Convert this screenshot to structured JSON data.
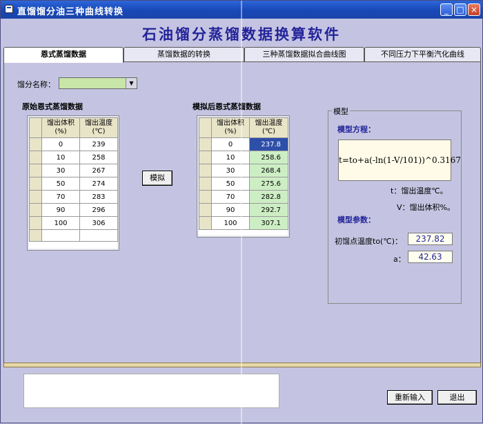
{
  "window": {
    "title": "直馏馏分油三种曲线转换",
    "min_symbol": "_",
    "max_symbol": "□",
    "close_symbol": "×"
  },
  "heading": "石油馏分蒸馏数据换算软件",
  "tabs": [
    "恩式蒸馏数据",
    "蒸馏数据的转换",
    "三种蒸馏数据拟合曲线图",
    "不同压力下平衡汽化曲线"
  ],
  "fraction": {
    "label": "馏分名称：",
    "value": ""
  },
  "original": {
    "title": "原始恩式蒸馏数据",
    "col1": "馏出体积\n(%)",
    "col2": "馏出温度\n(℃)",
    "rows": [
      [
        "0",
        "239"
      ],
      [
        "10",
        "258"
      ],
      [
        "30",
        "267"
      ],
      [
        "50",
        "274"
      ],
      [
        "70",
        "283"
      ],
      [
        "90",
        "296"
      ],
      [
        "100",
        "306"
      ]
    ]
  },
  "simulate_button": "模拟",
  "simulated": {
    "title": "模拟后恩式蒸馏数据",
    "col1": "馏出体积\n(%)",
    "col2": "馏出温度\n(℃)",
    "rows": [
      [
        "0",
        "237.8"
      ],
      [
        "10",
        "258.6"
      ],
      [
        "30",
        "268.4"
      ],
      [
        "50",
        "275.6"
      ],
      [
        "70",
        "282.8"
      ],
      [
        "90",
        "292.7"
      ],
      [
        "100",
        "307.1"
      ]
    ]
  },
  "model": {
    "group_label": "模型",
    "equation_title": "模型方程：",
    "equation": "t=to+a(-ln(1-V/101))^0.3167",
    "t_note": "t：馏出温度℃。",
    "v_note": "V：馏出体积%。",
    "params_title": "模型参数：",
    "t0_label": "初馏点温度to(℃)：",
    "t0_value": "237.82",
    "a_label": "a：",
    "a_value": "42.63"
  },
  "buttons": {
    "reset": "重新输入",
    "exit": "退出"
  }
}
